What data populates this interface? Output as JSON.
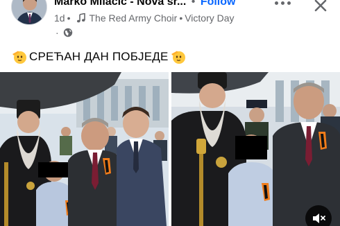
{
  "post": {
    "author": "Marko Milacic - Nova sr...",
    "follow_label": "Follow",
    "time": "1d",
    "music": {
      "artist": "The Red Army Choir",
      "song": "Victory Day",
      "separator": "•"
    },
    "caption": {
      "emoji": "🫡",
      "text": "СРЕЋАН ДАН ПОБЈЕДЕ"
    },
    "audience_icon": "globe-icon",
    "dot": "·"
  },
  "icons": {
    "more": "more-horizontal-icon",
    "close": "close-icon",
    "music": "music-note-icon",
    "mute": "speaker-muted-icon"
  },
  "colors": {
    "follow": "#0866ff",
    "secondary_text": "#65676b",
    "ribbon_orange": "#f07c1a",
    "ribbon_black": "#111111",
    "censor_bar": "#000000"
  }
}
